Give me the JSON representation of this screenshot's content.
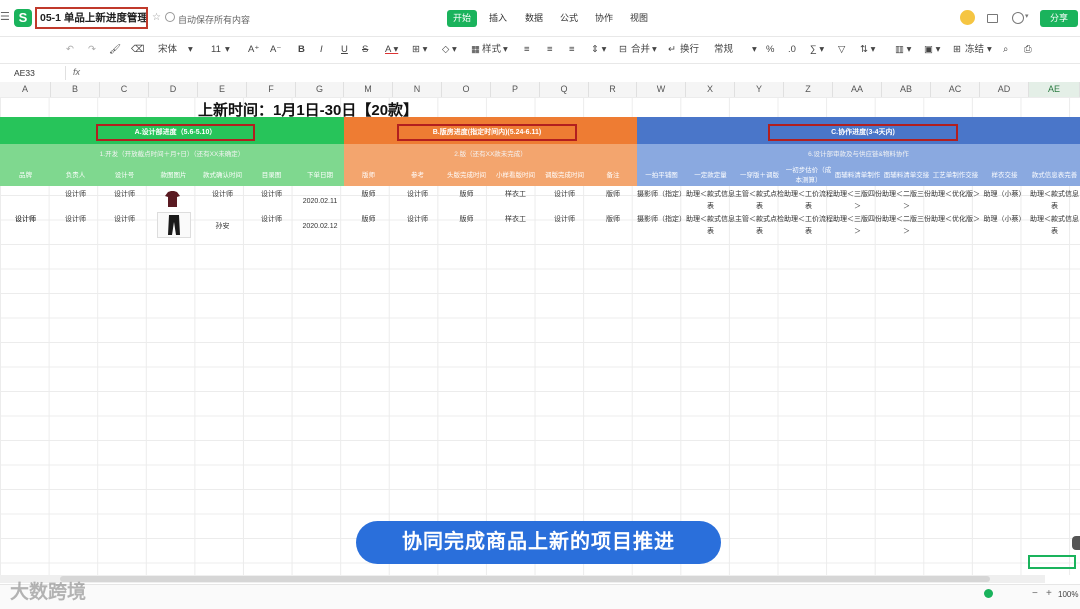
{
  "topbar": {
    "doc_title": "05-1 单品上新进度管理",
    "autosave": "自动保存所有内容",
    "tabs": [
      "开始",
      "插入",
      "数据",
      "公式",
      "协作",
      "视图"
    ],
    "share": "分享",
    "logo": "S"
  },
  "toolbar": {
    "font": "宋体",
    "size": "11",
    "style": "样式",
    "merge": "合并",
    "wrap": "换行",
    "format": "常规",
    "freeze": "冻结"
  },
  "formula_bar": {
    "cell_ref": "AE33",
    "fx": "fx"
  },
  "columns": [
    "A",
    "B",
    "C",
    "D",
    "E",
    "F",
    "G",
    "M",
    "N",
    "O",
    "P",
    "Q",
    "R",
    "W",
    "X",
    "Y",
    "Z",
    "AA",
    "AB",
    "AC",
    "AD",
    "AE"
  ],
  "sheet_title": "上新时间：1月1日-30日【20款】",
  "bands": {
    "a": {
      "label": "A.设计部进度（5.6-5.10）",
      "sub": "1.开发（开放截点时间＋月+日）（还有XX未确定）",
      "color": "#27c45a",
      "sub_color": "#7fd88f"
    },
    "b": {
      "label": "B.版房进度(指定时间内)(5.24-6.11)",
      "sub": "2.版（还有XX款未完成）",
      "color": "#ee7c33",
      "sub_color": "#f3a56e"
    },
    "c": {
      "label": "C.协作进度(3-4天内)",
      "sub": "6.设计部审款及与供应链&物料协作",
      "color": "#4a76c9",
      "sub_color": "#8aa9e0"
    }
  },
  "headers": [
    "品牌",
    "负责人",
    "设计号",
    "款图图片",
    "款式确认时间",
    "目录图",
    "下单日期",
    "版师",
    "参考",
    "头版完成时间",
    "小样看版时间",
    "调版完成时间",
    "备注",
    "一拍平铺图",
    "一定款定量",
    "一穿版＋调版",
    "一初步估价（成本测算）",
    "面辅料清单制作",
    "面辅料清单交接",
    "工艺单制作交接",
    "样衣交接",
    "款式信息表完善"
  ],
  "rows": [
    [
      "设计师",
      "设计师",
      "设计师",
      "",
      "设计师",
      "设计师",
      "2020.02.11",
      "版师",
      "设计师",
      "版师",
      "样衣工",
      "设计师",
      "版师",
      "摄影师（指定）",
      "助理＜款式信息表",
      "主管＜款式点检表",
      "助理＜工价流程表",
      "助理＜三版四份＞",
      "助理＜二版三份＞",
      "助理＜优化版＞",
      "助理（小蔡）",
      "助理＜款式信息表"
    ],
    [
      "设计师",
      "设计师",
      "设计师",
      "",
      "孙安",
      "设计师",
      "2020.02.12",
      "版师",
      "设计师",
      "版师",
      "样衣工",
      "设计师",
      "版师",
      "摄影师（指定）",
      "助理＜款式信息表",
      "主管＜款式点检表",
      "助理＜工价流程表",
      "助理＜三版四份＞",
      "助理＜二版三份＞",
      "助理＜优化版＞",
      "助理（小蔡）",
      "助理＜款式信息表"
    ]
  ],
  "caption": "协同完成商品上新的项目推进",
  "watermark": "大数跨境",
  "zoom": "100%",
  "colors": {
    "accent": "#1ab35c",
    "highlight_border": "#b21f1f",
    "caption_bg": "#2a6fdb"
  }
}
